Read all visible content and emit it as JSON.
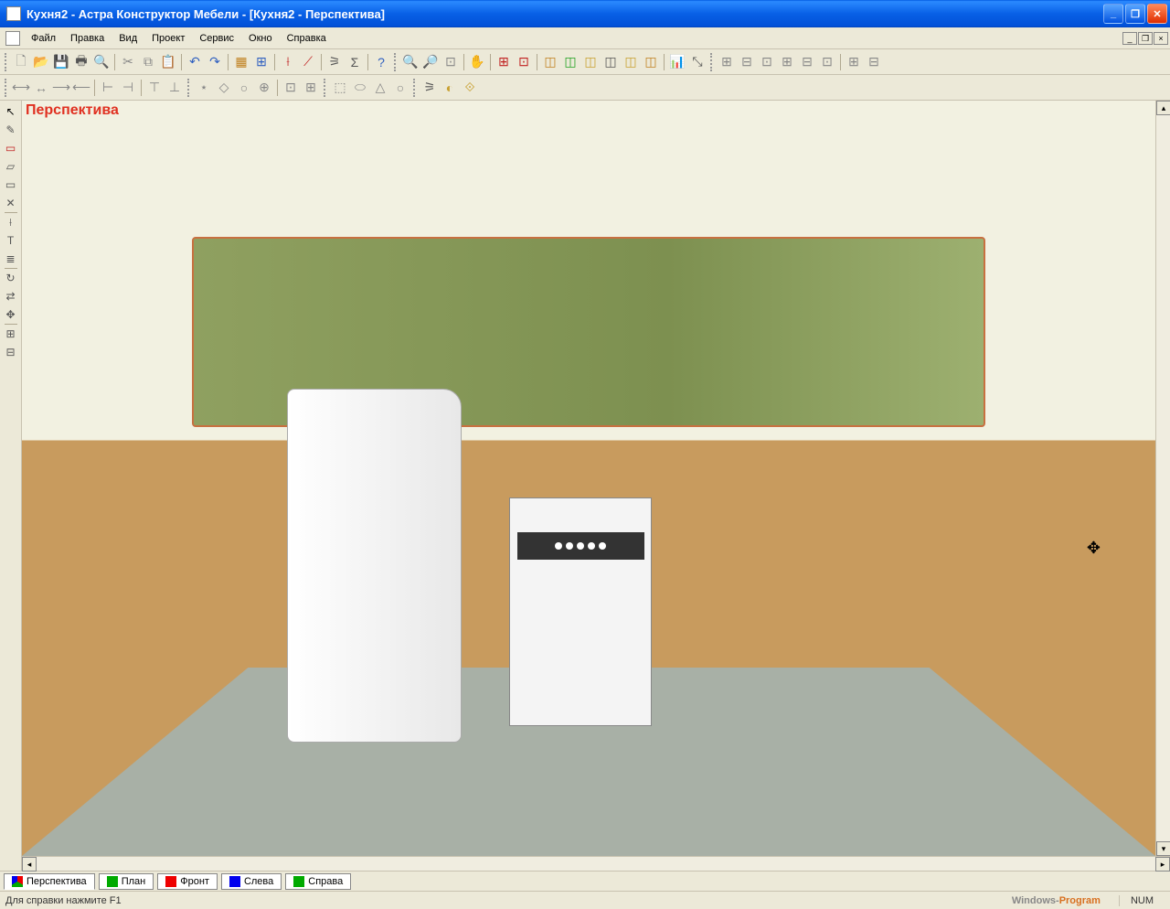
{
  "titlebar": {
    "title": "Кухня2 - Астра Конструктор Мебели - [Кухня2 - Перспектива]"
  },
  "menubar": {
    "items": [
      "Файл",
      "Правка",
      "Вид",
      "Проект",
      "Сервис",
      "Окно",
      "Справка"
    ]
  },
  "viewport": {
    "label": "Перспектива"
  },
  "view_tabs": [
    {
      "label": "Перспектива",
      "active": true
    },
    {
      "label": "План",
      "active": false
    },
    {
      "label": "Фронт",
      "active": false
    },
    {
      "label": "Слева",
      "active": false
    },
    {
      "label": "Справа",
      "active": false
    }
  ],
  "statusbar": {
    "help": "Для справки нажмите F1",
    "watermark_a": "Windows-",
    "watermark_b": "Program",
    "num": "NUM"
  }
}
